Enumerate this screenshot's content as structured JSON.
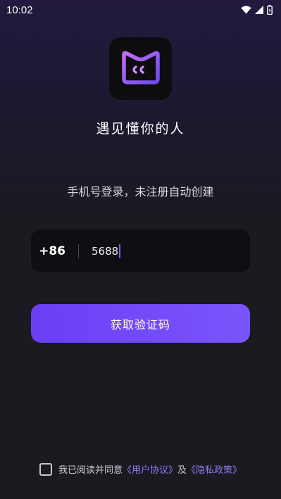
{
  "status_bar": {
    "time": "10:02",
    "icons": [
      "wifi-icon",
      "signal-icon",
      "battery-icon"
    ]
  },
  "logo": {
    "icon": "app-logo-icon"
  },
  "slogan": "遇见懂你的人",
  "subtitle": "手机号登录，未注册自动创建",
  "phone": {
    "country_code": "+86",
    "value": "5688"
  },
  "primary_button": {
    "label": "获取验证码"
  },
  "agreement": {
    "prefix": "我已阅读并同意",
    "user_agreement": "《用户协议》",
    "conjunction": "及",
    "privacy_policy": "《隐私政策》",
    "checked": false
  },
  "colors": {
    "accent": "#7a55fb",
    "link": "#8d7bf2",
    "background": "#1a1a20"
  }
}
